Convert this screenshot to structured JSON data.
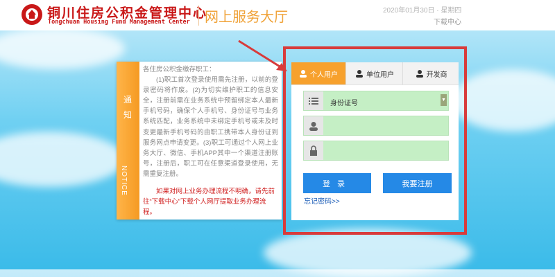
{
  "header": {
    "brand_cn": "铜川住房公积金管理中心",
    "brand_en": "Tongchuan Housing Fund Management Center",
    "portal_title": "网上服务大厅",
    "date": "2020年01月30日 · 星期四",
    "download_label": "下载中心"
  },
  "notice": {
    "side_cn": "通知",
    "side_en": "NOTICE",
    "greeting": "各住房公积金缴存职工：",
    "body": "(1)职工首次登录使用需先注册，以前的登录密码将作废。(2)为切实维护职工的信息安全，注册前需在业务系统中预留绑定本人最新手机号码，确保个人手机号、身份证号与业务系统匹配，业务系统中未绑定手机号或未及时变更最新手机号码的由职工携带本人身份证到服务网点申请变更。(3)职工可通过个人网上业务大厅、微信、手机APP其中一个渠道注册账号，注册后，职工可在任意渠道登录使用，无需重复注册。",
    "red_text": "如果对网上业务办理流程不明确，请先前往“下载中心”下载个人网厅提取业务办理流程。"
  },
  "login": {
    "tabs": [
      {
        "label": "个人用户",
        "active": true,
        "icon": "person-icon"
      },
      {
        "label": "单位用户",
        "active": false,
        "icon": "person-icon"
      },
      {
        "label": "开发商",
        "active": false,
        "icon": "person-icon"
      }
    ],
    "id_type_selected": "身份证号",
    "username_placeholder": "",
    "password_placeholder": "",
    "login_label": "登录",
    "register_label": "我要注册",
    "forgot_label": "忘记密码>>"
  },
  "colors": {
    "brand_red": "#c91818",
    "accent_orange": "#f7a12d",
    "button_blue": "#2589e6",
    "field_green": "#c5efc5",
    "annotation_red": "#d83b3b"
  }
}
